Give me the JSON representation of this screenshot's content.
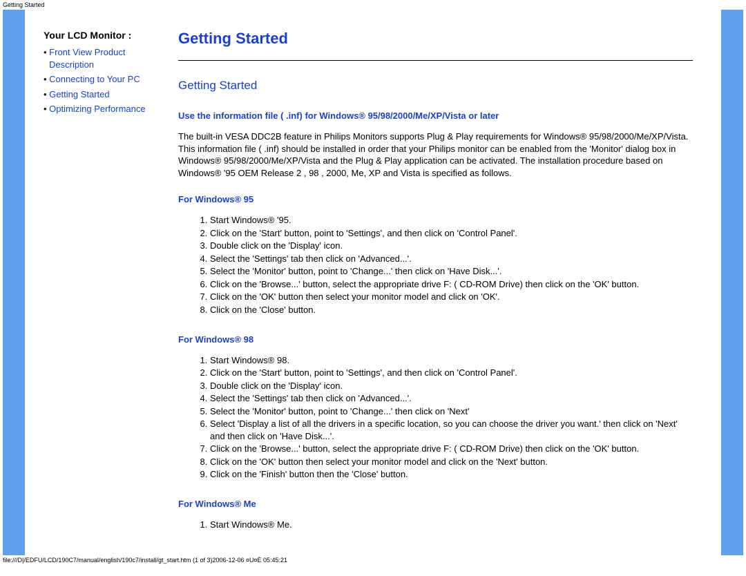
{
  "header": "Getting Started",
  "sidebar": {
    "title": "Your LCD Monitor :",
    "items": [
      "Front View Product Description",
      "Connecting to Your PC",
      "Getting Started",
      "Optimizing Performance"
    ]
  },
  "main": {
    "h1": "Getting Started",
    "h2": "Getting Started",
    "sub_bold": "Use the information file ( .inf) for Windows® 95/98/2000/Me/XP/Vista or later",
    "intro": "The built-in VESA DDC2B feature in Philips Monitors supports Plug & Play requirements for Windows® 95/98/2000/Me/XP/Vista. This information file ( .inf) should be installed in order that your Philips monitor can be enabled from the 'Monitor' dialog box in Windows® 95/98/2000/Me/XP/Vista and the Plug & Play application can be activated. The installation procedure based on Windows® '95 OEM Release 2 , 98 , 2000, Me, XP and Vista is specified as follows.",
    "sections": [
      {
        "title": "For Windows® 95",
        "steps": [
          "Start Windows® '95.",
          "Click on the 'Start' button, point to 'Settings', and then click on 'Control Panel'.",
          "Double click on the 'Display' icon.",
          "Select the 'Settings' tab then click on 'Advanced...'.",
          "Select the 'Monitor' button, point to 'Change...' then click on 'Have Disk...'.",
          "Click on the 'Browse...' button, select the appropriate drive F: ( CD-ROM Drive) then click on the 'OK' button.",
          "Click on the 'OK' button then select your monitor model and click on 'OK'.",
          "Click on the 'Close' button."
        ]
      },
      {
        "title": "For Windows® 98",
        "steps": [
          "Start Windows® 98.",
          "Click on the 'Start' button, point to 'Settings', and then click on 'Control Panel'.",
          "Double click on the 'Display' icon.",
          "Select the 'Settings' tab then click on 'Advanced...'.",
          "Select the 'Monitor' button, point to 'Change...' then click on 'Next'",
          "Select 'Display a list of all the drivers in a specific location, so you can choose the driver you want.' then click on 'Next' and then click on 'Have Disk...'.",
          "Click on the 'Browse...' button, select the appropriate drive F: ( CD-ROM Drive) then click on the 'OK' button.",
          "Click on the 'OK' button then select your monitor model and click on the 'Next' button.",
          "Click on the 'Finish' button then the 'Close' button."
        ]
      },
      {
        "title": "For Windows® Me",
        "steps": [
          "Start Windows® Me."
        ]
      }
    ]
  },
  "footer": "file:///D|/EDFU/LCD/190C7/manual/english/190c7/install/gt_start.htm (1 of 3)2006-12-06 ¤U¤È 05:45:21"
}
